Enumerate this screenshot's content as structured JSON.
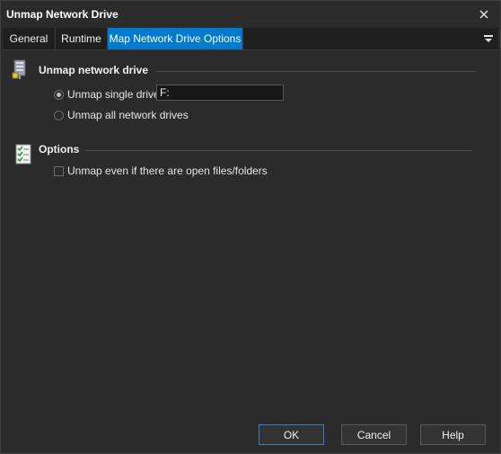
{
  "window": {
    "title": "Unmap Network Drive"
  },
  "tabs": [
    {
      "label": "General"
    },
    {
      "label": "Runtime"
    },
    {
      "label": "Map Network Drive Options"
    }
  ],
  "section_unmap": {
    "title": "Unmap network drive",
    "radio_single_label": "Unmap single drive",
    "radio_all_label": "Unmap all network drives",
    "drive_value": "F:"
  },
  "section_options": {
    "title": "Options",
    "checkbox_label": "Unmap even if there are open files/folders"
  },
  "buttons": {
    "ok": "OK",
    "cancel": "Cancel",
    "help": "Help"
  },
  "colors": {
    "accent": "#007acc",
    "background": "#2b2b2b"
  }
}
